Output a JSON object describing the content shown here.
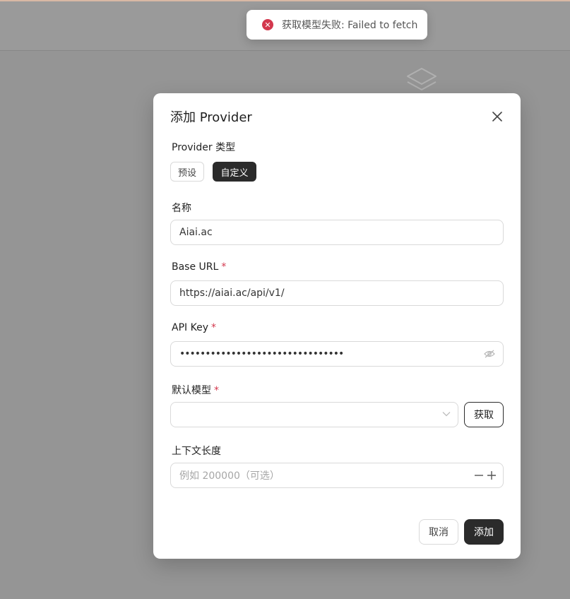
{
  "toast": {
    "icon": "error-circle-icon",
    "message": "获取模型失败: Failed to fetch",
    "accent": "#d3384e"
  },
  "modal": {
    "title": "添加 Provider",
    "provider_type": {
      "label": "Provider 类型",
      "options": [
        "预设",
        "自定义"
      ],
      "selected": "自定义"
    },
    "name": {
      "label": "名称",
      "value": "Aiai.ac"
    },
    "base_url": {
      "label": "Base URL",
      "required_mark": "*",
      "value": "https://aiai.ac/api/v1/"
    },
    "api_key": {
      "label": "API Key",
      "required_mark": "*",
      "value": "••••••••••••••••••••••••••••••••"
    },
    "default_model": {
      "label": "默认模型",
      "required_mark": "*",
      "value": "",
      "fetch_label": "获取"
    },
    "context_length": {
      "label": "上下文长度",
      "placeholder": "例如 200000（可选）"
    },
    "cancel_label": "取消",
    "submit_label": "添加"
  },
  "colors": {
    "overlay": "#959595",
    "primary_button": "#2b2b2b",
    "required": "#d3384e"
  }
}
